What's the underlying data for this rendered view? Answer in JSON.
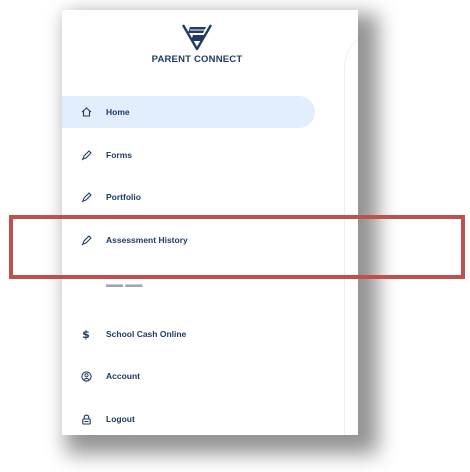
{
  "brand": {
    "name": "PARENT CONNECT",
    "logo_icon": "flag-logo-icon",
    "color": "#1f3b64"
  },
  "colors": {
    "active_bg": "#e2eefb",
    "highlight": "#c0504d",
    "text": "#1f3b64"
  },
  "nav": {
    "items": [
      {
        "label": "Home",
        "icon": "home-icon",
        "active": true
      },
      {
        "label": "Forms",
        "icon": "pen-icon"
      },
      {
        "label": "Portfolio",
        "icon": "pen-icon"
      },
      {
        "label": "Assessment History",
        "icon": "pen-icon"
      },
      {
        "label": "School Cash Online",
        "icon": "dollar-icon",
        "glyph": "$"
      },
      {
        "label": "Account",
        "icon": "account-icon"
      },
      {
        "label": "Logout",
        "icon": "lock-icon"
      }
    ]
  }
}
